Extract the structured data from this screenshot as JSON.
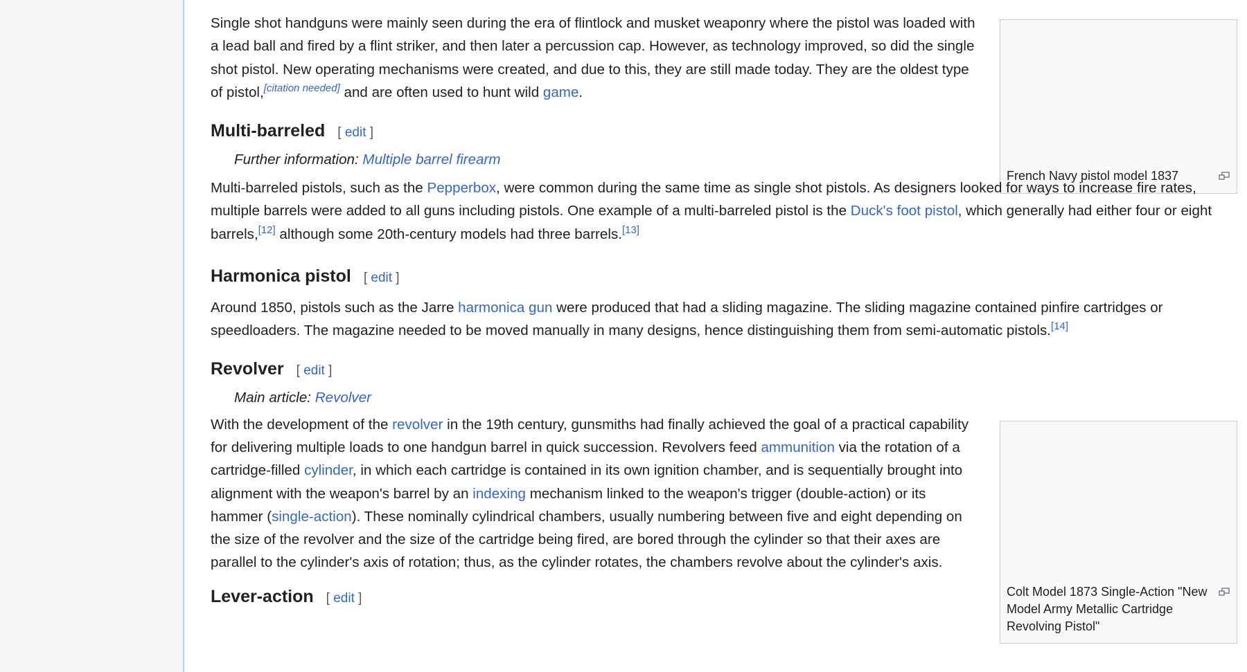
{
  "sections": {
    "single_shot": {
      "parts": [
        "Single shot handguns were mainly seen during the era of flintlock and musket weaponry where the pistol was loaded with a lead ball and fired by a flint striker, and then later a percussion cap. However, as technology improved, so did the single shot pistol. New operating mechanisms were created, and due to this, they are still made today. They are the oldest type of pistol,",
        "[citation needed]",
        " and are often used to hunt wild ",
        "game",
        "."
      ]
    },
    "multi_barreled": {
      "heading": "Multi-barreled",
      "edit_open": "[ ",
      "edit_label": "edit",
      "edit_close": " ]",
      "hatnote_prefix": "Further information: ",
      "hatnote_link": "Multiple barrel firearm",
      "parts": [
        "Multi-barreled pistols, such as the ",
        "Pepperbox",
        ", were common during the same time as single shot pistols. As designers looked for ways to increase fire rates, multiple barrels were added to all guns including pistols. One example of a multi-barreled pistol is the ",
        "Duck's foot pistol",
        ", which generally had either four or eight barrels,",
        "[12]",
        " although some 20th-century models had three barrels.",
        "[13]"
      ]
    },
    "harmonica": {
      "heading": "Harmonica pistol",
      "edit_open": "[ ",
      "edit_label": "edit",
      "edit_close": " ]",
      "parts": [
        "Around 1850, pistols such as the Jarre ",
        "harmonica gun",
        " were produced that had a sliding magazine. The sliding magazine contained pinfire cartridges or speedloaders. The magazine needed to be moved manually in many designs, hence distinguishing them from semi-automatic pistols.",
        "[14]"
      ]
    },
    "revolver": {
      "heading": "Revolver",
      "edit_open": "[ ",
      "edit_label": "edit",
      "edit_close": " ]",
      "hatnote_prefix": "Main article: ",
      "hatnote_link": "Revolver",
      "parts": [
        "With the development of the ",
        "revolver",
        " in the 19th century, gunsmiths had finally achieved the goal of a practical capability for delivering multiple loads to one handgun barrel in quick succession. Revolvers feed ",
        "ammunition",
        " via the rotation of a cartridge-filled ",
        "cylinder",
        ", in which each cartridge is contained in its own ignition chamber, and is sequentially brought into alignment with the weapon's barrel by an ",
        "indexing",
        " mechanism linked to the weapon's trigger (double-action) or its hammer (",
        "single-action",
        "). These nominally cylindrical chambers, usually numbering between five and eight depending on the size of the revolver and the size of the cartridge being fired, are bored through the cylinder so that their axes are parallel to the cylinder's axis of rotation; thus, as the cylinder rotates, the chambers revolve about the cylinder's axis."
      ]
    },
    "lever_action": {
      "heading": "Lever-action",
      "edit_open": "[ ",
      "edit_label": "edit",
      "edit_close": " ]"
    }
  },
  "figures": {
    "french_navy": {
      "caption": "French Navy pistol model 1837",
      "icon": "magnify-icon"
    },
    "colt": {
      "caption": "Colt Model 1873 Single-Action \"New Model Army Metallic Cartridge Revolving Pistol\"",
      "icon": "magnify-icon"
    }
  },
  "colors": {
    "link": "#3366cc",
    "text": "#202122",
    "border": "#a7d7f9"
  }
}
